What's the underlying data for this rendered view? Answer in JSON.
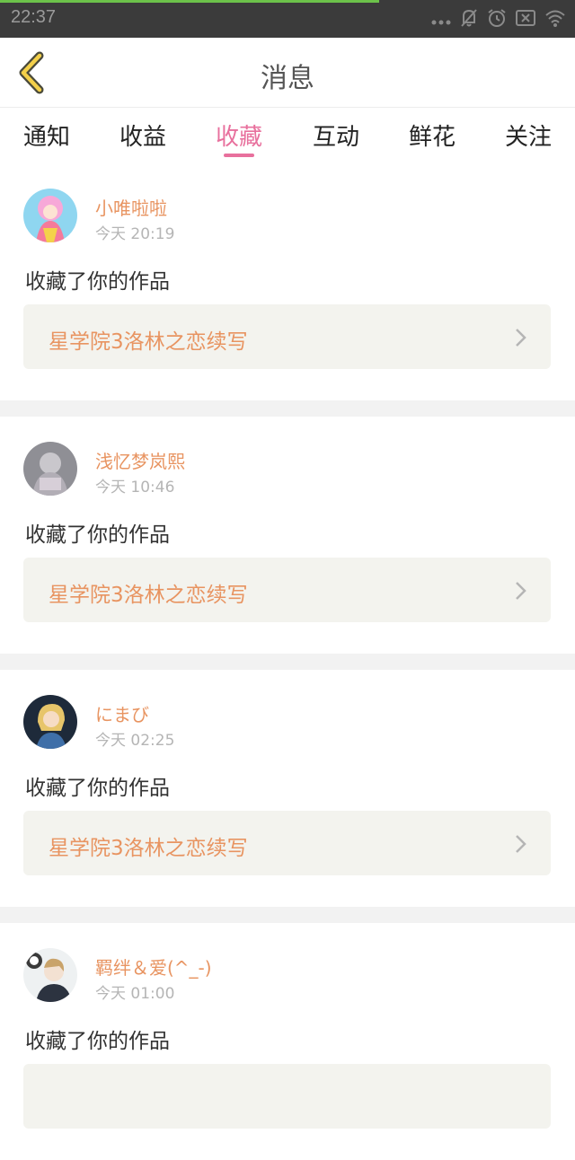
{
  "status_bar": {
    "time": "22:37",
    "progress": 0.66,
    "icons": [
      "more-dots-icon",
      "mute-bell-icon",
      "alarm-icon",
      "sim-off-icon",
      "wifi-icon"
    ]
  },
  "header": {
    "title": "消息",
    "back_icon": "chevron-left-icon"
  },
  "tabs": [
    {
      "label": "通知",
      "active": false
    },
    {
      "label": "收益",
      "active": false
    },
    {
      "label": "收藏",
      "active": true
    },
    {
      "label": "互动",
      "active": false
    },
    {
      "label": "鲜花",
      "active": false
    },
    {
      "label": "关注",
      "active": false
    }
  ],
  "colors": {
    "accent": "#e8709d",
    "name": "#e89461",
    "card_bg": "#f3f3ee"
  },
  "messages": [
    {
      "user": "小唯啦啦",
      "time": "今天 20:19",
      "action": "收藏了你的作品",
      "work": "星学院3洛林之恋续写"
    },
    {
      "user": "浅忆梦岚熙",
      "time": "今天 10:46",
      "action": "收藏了你的作品",
      "work": "星学院3洛林之恋续写"
    },
    {
      "user": "にまび",
      "time": "今天 02:25",
      "action": "收藏了你的作品",
      "work": "星学院3洛林之恋续写"
    },
    {
      "user": "羁绊＆爱(^_-)",
      "time": "今天 01:00",
      "action": "收藏了你的作品",
      "work": ""
    }
  ]
}
